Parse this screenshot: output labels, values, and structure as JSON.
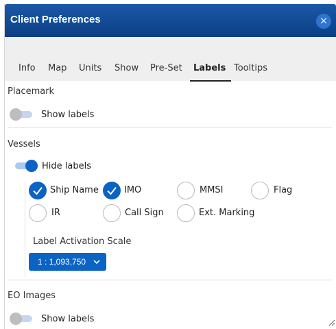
{
  "window": {
    "title": "Client Preferences",
    "close_icon": "close-icon"
  },
  "tabs": [
    {
      "label": "Info",
      "active": false
    },
    {
      "label": "Map",
      "active": false
    },
    {
      "label": "Units",
      "active": false
    },
    {
      "label": "Show",
      "active": false
    },
    {
      "label": "Pre-Set",
      "active": false
    },
    {
      "label": "Labels",
      "active": true
    },
    {
      "label": "Tooltips",
      "active": false
    }
  ],
  "placemark": {
    "heading": "Placemark",
    "toggle_label": "Show labels",
    "toggle_on": false
  },
  "vessels": {
    "heading": "Vessels",
    "toggle_label": "Hide labels",
    "toggle_on": true,
    "options": [
      {
        "label": "Ship Name",
        "checked": true
      },
      {
        "label": "IMO",
        "checked": true
      },
      {
        "label": "MMSI",
        "checked": false
      },
      {
        "label": "Flag",
        "checked": false
      },
      {
        "label": "IR",
        "checked": false
      },
      {
        "label": "Call Sign",
        "checked": false
      },
      {
        "label": "Ext. Marking",
        "checked": false
      }
    ],
    "scale_label": "Label Activation Scale",
    "scale_value": "1 : 1,093,750",
    "scale_icon": "chevron-down-icon"
  },
  "eo_images": {
    "heading": "EO Images",
    "toggle_label": "Show labels",
    "toggle_on": false
  },
  "colors": {
    "title_bar": "#0c3f85",
    "accent": "#0b63c5",
    "tab_bar": "#efefef"
  }
}
